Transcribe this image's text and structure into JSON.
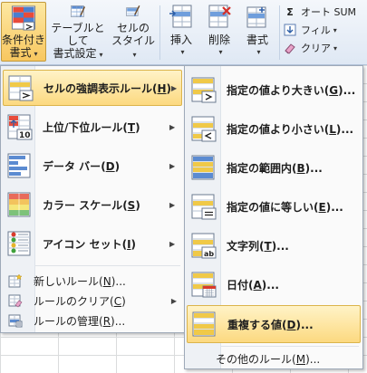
{
  "ribbon": {
    "cond_format": {
      "line1": "条件付き",
      "line2": "書式"
    },
    "table_format": {
      "line1": "テーブルとして",
      "line2": "書式設定"
    },
    "cell_style": {
      "line1": "セルの",
      "line2": "スタイル"
    },
    "insert": {
      "label": "挿入"
    },
    "delete": {
      "label": "削除"
    },
    "format": {
      "label": "書式"
    },
    "autosum": {
      "icon": "Σ",
      "label": "オート SUM"
    },
    "fill": {
      "label": "フィル"
    },
    "clear": {
      "label": "クリア"
    }
  },
  "main_menu": {
    "items": [
      {
        "label": "セルの強調表示ルール",
        "key": "H",
        "icon": "highlight-cells-rules-icon"
      },
      {
        "label": "上位/下位ルール",
        "key": "T",
        "icon": "top-bottom-rules-icon"
      },
      {
        "label": "データ バー",
        "key": "D",
        "icon": "data-bars-icon"
      },
      {
        "label": "カラー スケール",
        "key": "S",
        "icon": "color-scales-icon"
      },
      {
        "label": "アイコン セット",
        "key": "I",
        "icon": "icon-sets-icon"
      }
    ],
    "small_items": [
      {
        "label": "新しいルール",
        "key": "N",
        "suffix": "..."
      },
      {
        "label": "ルールのクリア",
        "key": "C",
        "suffix": ""
      },
      {
        "label": "ルールの管理",
        "key": "R",
        "suffix": "..."
      }
    ]
  },
  "sub_menu": {
    "items": [
      {
        "label": "指定の値より大きい",
        "key": "G",
        "suffix": "...",
        "icon": "greater-than-icon"
      },
      {
        "label": "指定の値より小さい",
        "key": "L",
        "suffix": "...",
        "icon": "less-than-icon"
      },
      {
        "label": "指定の範囲内",
        "key": "B",
        "suffix": "...",
        "icon": "between-icon"
      },
      {
        "label": "指定の値に等しい",
        "key": "E",
        "suffix": "...",
        "icon": "equal-to-icon"
      },
      {
        "label": "文字列",
        "key": "T",
        "suffix": "...",
        "icon": "text-contains-icon"
      },
      {
        "label": "日付",
        "key": "A",
        "suffix": "...",
        "icon": "date-occurring-icon"
      },
      {
        "label": "重複する値",
        "key": "D",
        "suffix": "...",
        "icon": "duplicate-values-icon"
      }
    ],
    "more": {
      "label": "その他のルール",
      "key": "M",
      "suffix": "..."
    }
  },
  "colors": {
    "highlight_top": "#fff3c7",
    "highlight_bottom": "#fcd980",
    "highlight_border": "#dbb44b",
    "gutter": "#eef1f5"
  }
}
